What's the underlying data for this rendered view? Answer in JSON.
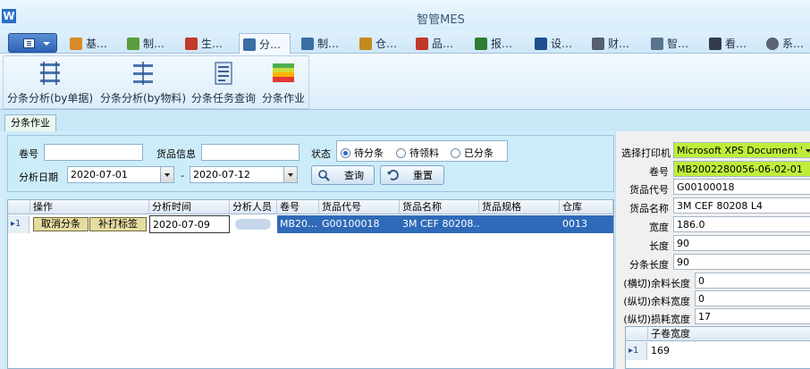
{
  "window": {
    "title": "智管MES",
    "logo_letter": "W"
  },
  "ribbon_tabs": [
    {
      "label": "基…",
      "icon": "base-icon",
      "color": "#d98a2b"
    },
    {
      "label": "制…",
      "icon": "chart-edit-icon",
      "color": "#5a9d3c"
    },
    {
      "label": "生…",
      "icon": "production-icon",
      "color": "#c0392b"
    },
    {
      "label": "分…",
      "icon": "scissors-icon",
      "color": "#3a6ea5",
      "active": true
    },
    {
      "label": "制…",
      "icon": "search-doc-icon",
      "color": "#3a6ea5"
    },
    {
      "label": "仓…",
      "icon": "warehouse-box-icon",
      "color": "#c58a1c"
    },
    {
      "label": "品…",
      "icon": "diamond-icon",
      "color": "#c0392b"
    },
    {
      "label": "报…",
      "icon": "report-icon",
      "color": "#2e7d32"
    },
    {
      "label": "设…",
      "icon": "device-icon",
      "color": "#1f4f8f"
    },
    {
      "label": "财…",
      "icon": "tag-icon",
      "color": "#555f6d"
    },
    {
      "label": "智…",
      "icon": "smart-icon",
      "color": "#5a7390"
    },
    {
      "label": "看…",
      "icon": "monitor-icon",
      "color": "#333d4a"
    },
    {
      "label": "系…",
      "icon": "gear-icon",
      "color": "#5a6470"
    }
  ],
  "ribbon_buttons": [
    {
      "label": "分条分析(by单据)",
      "icon": "slit-by-document-icon"
    },
    {
      "label": "分条分析(by物料)",
      "icon": "slit-by-material-icon"
    },
    {
      "label": "分条任务查询",
      "icon": "task-query-icon"
    },
    {
      "label": "分条作业",
      "icon": "slit-operation-icon"
    }
  ],
  "doc_tab": {
    "label": "分条作业"
  },
  "filter": {
    "roll_no_label": "卷号",
    "roll_no_value": "",
    "goods_info_label": "货品信息",
    "goods_info_value": "",
    "status_label": "状态",
    "status_options": [
      {
        "label": "待分条",
        "checked": true
      },
      {
        "label": "待领料",
        "checked": false
      },
      {
        "label": "已分条",
        "checked": false
      }
    ],
    "date_label": "分析日期",
    "date_from": "2020-07-01",
    "date_sep": "-",
    "date_to": "2020-07-12",
    "query_label": "查询",
    "reset_label": "重置"
  },
  "grid": {
    "columns": [
      "操作",
      "分析时间",
      "分析人员",
      "卷号",
      "货品代号",
      "货品名称",
      "货品规格",
      "仓库"
    ],
    "rows": [
      {
        "indicator": "▸1",
        "actions": [
          "取消分条",
          "补打标签"
        ],
        "time": "2020-07-09",
        "analyst": "",
        "roll_no": "MB20…",
        "goods_code": "G00100018",
        "goods_name": "3M CEF 80208…",
        "goods_spec": "",
        "warehouse": "0013"
      }
    ]
  },
  "detail": {
    "printer_label": "选择打印机",
    "printer_value": "Microsoft XPS Document Wr",
    "roll_no_label": "卷号",
    "roll_no_value": "MB2002280056-06-02-01",
    "goods_code_label": "货品代号",
    "goods_code_value": "G00100018",
    "goods_name_label": "货品名称",
    "goods_name_value": "3M CEF 80208 L4",
    "width_label": "宽度",
    "width_value": "186.0",
    "length_label": "长度",
    "length_value": "90",
    "slit_length_label": "分条长度",
    "slit_length_value": "90",
    "cross_remain_length_label": "(横切)余料长度",
    "cross_remain_length_value": "0",
    "long_remain_width_label": "(纵切)余料宽度",
    "long_remain_width_value": "0",
    "long_loss_width_label": "(纵切)损耗宽度",
    "long_loss_width_value": "17",
    "sub_grid": {
      "column": "子卷宽度",
      "rows": [
        {
          "indicator": "▸1",
          "value": "169"
        }
      ]
    }
  }
}
